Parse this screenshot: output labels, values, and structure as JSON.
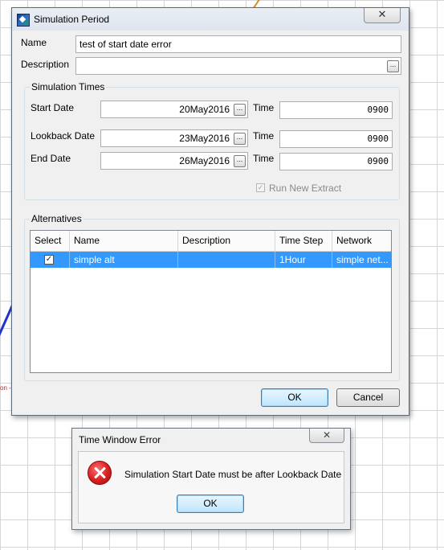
{
  "dialog": {
    "title": "Simulation Period",
    "close_glyph": "✕",
    "name_label": "Name",
    "name_value": "test of start date error",
    "description_label": "Description",
    "description_value": "",
    "ellipsis": "...",
    "sim_times": {
      "title": "Simulation Times",
      "start_label": "Start Date",
      "start_date": "20May2016",
      "lookback_label": "Lookback Date",
      "lookback_date": "23May2016",
      "end_label": "End Date",
      "end_date": "26May2016",
      "time_label": "Time",
      "start_time": "0900",
      "lookback_time": "0900",
      "end_time": "0900",
      "run_new_extract_label": "Run New Extract",
      "run_new_extract_checked": true
    },
    "alternatives": {
      "title": "Alternatives",
      "columns": [
        "Select",
        "Name",
        "Description",
        "Time Step",
        "Network"
      ],
      "rows": [
        {
          "selected": true,
          "name": "simple alt",
          "description": "",
          "time_step": "1Hour",
          "network": "simple net..."
        }
      ]
    },
    "ok_label": "OK",
    "cancel_label": "Cancel"
  },
  "error_dialog": {
    "title": "Time Window Error",
    "close_glyph": "✕",
    "message": "Simulation Start Date must be after Lookback Date",
    "ok_label": "OK"
  },
  "colors": {
    "selection": "#3399ff",
    "error_icon": "#d81f1f"
  }
}
